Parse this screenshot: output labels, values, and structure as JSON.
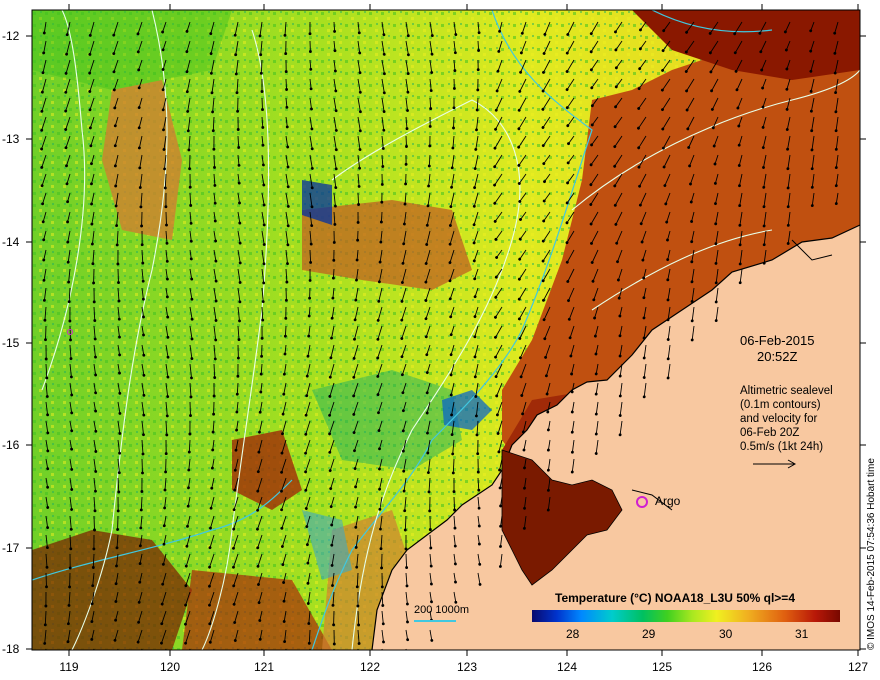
{
  "map": {
    "date": "06-Feb-2015",
    "time": "20:52Z",
    "info_lines": [
      "Altimetric sealevel",
      "(0.1m contours)",
      "and velocity for",
      "06-Feb 20Z",
      "0.5m/s (1kt 24h)"
    ],
    "colorbar_title": "Temperature (°C) NOAA18_L3U 50% ql>=4",
    "colorbar_ticks": [
      "28",
      "29",
      "30",
      "31"
    ],
    "credit": "© IMOS 14-Feb-2015 07:54:36 Hobart time",
    "scale_label": "200  1000m",
    "argo_label": "Argo",
    "y_axis_labels": [
      "-12",
      "-13",
      "-14",
      "-15",
      "-16",
      "-17",
      "-18"
    ],
    "x_axis_labels": [
      "119",
      "120",
      "121",
      "122",
      "123",
      "124",
      "125",
      "126",
      "127"
    ],
    "colors": {
      "land": "#f8c8a0",
      "contour": "#e8ffe8",
      "bathymetry": "#40c8e0",
      "argo": "#d020d0"
    }
  }
}
